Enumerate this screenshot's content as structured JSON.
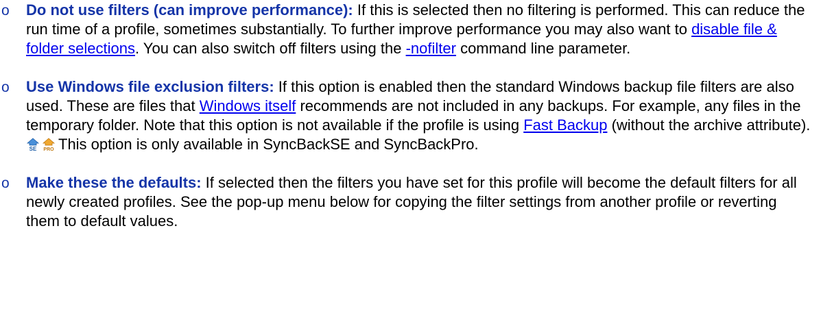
{
  "items": [
    {
      "bullet": "o",
      "term": "Do not use filters (can improve performance):",
      "text_1": " If this is selected then no filtering is performed. This can reduce the run time of a profile, sometimes substantially. To further improve performance you may also want to ",
      "link_1": "disable file & folder selections",
      "text_2": ". You can also switch off filters using the ",
      "link_2": "-nofilter",
      "text_3": " command line parameter."
    },
    {
      "bullet": "o",
      "term": "Use Windows file exclusion filters:",
      "text_1": " If this option is enabled then the standard Windows backup file filters are also used. These are files that ",
      "link_1": "Windows itself",
      "text_2": " recommends are not included in any backups. For example, any files in the temporary folder. Note that this option is not available if the profile is using ",
      "link_2": "Fast Backup",
      "text_3": " (without the archive attribute).",
      "icons": [
        "se-edition-icon",
        "pro-edition-icon"
      ],
      "availability_note": "This option is only available in SyncBackSE and SyncBackPro."
    },
    {
      "bullet": "o",
      "term": "Make these the defaults:",
      "text_1": " If selected then the filters you have set for this profile will become the default filters for all newly created profiles. See the pop-up menu below for copying the filter settings from another profile or reverting them to default values."
    }
  ],
  "colors": {
    "term": "#1535a8",
    "link": "#0000ee",
    "text": "#000000"
  }
}
